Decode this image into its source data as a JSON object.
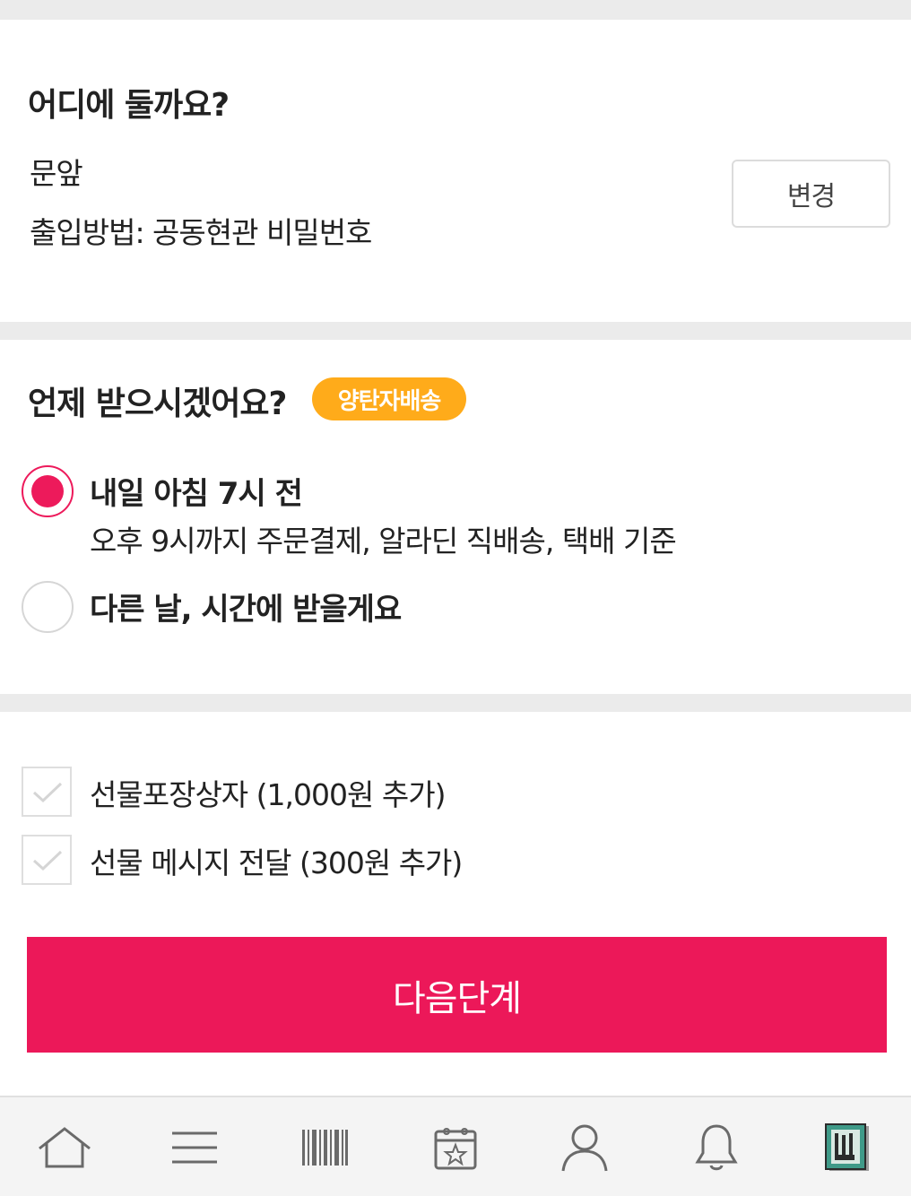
{
  "location": {
    "heading": "어디에 둘까요?",
    "place": "문앞",
    "access_method": "출입방법: 공동현관 비밀번호",
    "change_label": "변경"
  },
  "delivery_time": {
    "heading": "언제 받으시겠어요?",
    "badge": "양탄자배송",
    "options": [
      {
        "label": "내일 아침 7시 전",
        "sub": "오후 9시까지 주문결제, 알라딘 직배송, 택배 기준",
        "selected": true
      },
      {
        "label": "다른 날, 시간에 받을게요",
        "selected": false
      }
    ]
  },
  "gift_options": [
    {
      "label": "선물포장상자 (1,000원 추가)",
      "checked": false
    },
    {
      "label": "선물 메시지 전달 (300원 추가)",
      "checked": false
    }
  ],
  "next_button": "다음단계",
  "colors": {
    "accent": "#ec1859",
    "badge": "#ffab1a"
  },
  "tabbar": [
    "home-icon",
    "menu-icon",
    "barcode-icon",
    "calendar-star-icon",
    "profile-icon",
    "bell-icon",
    "book-cover-icon"
  ]
}
